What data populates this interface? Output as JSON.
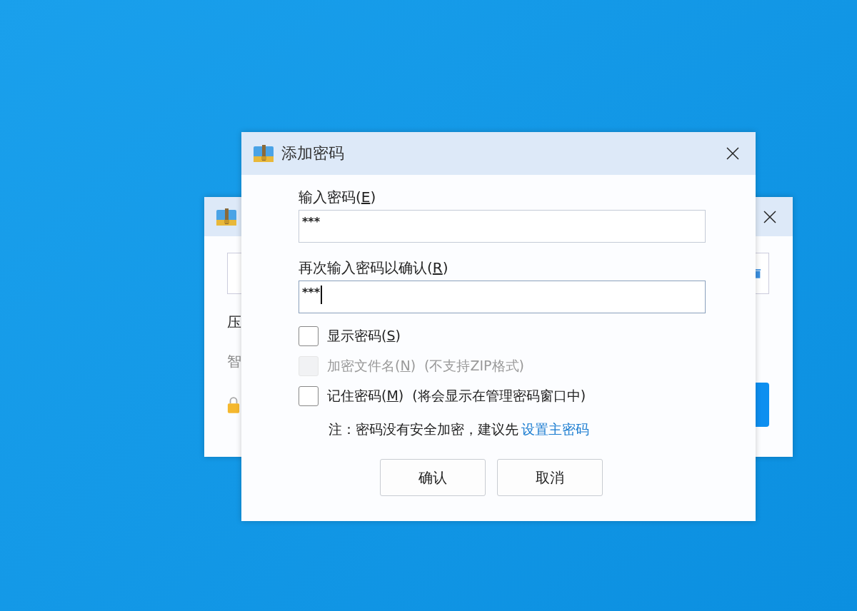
{
  "background_window": {
    "labels": [
      {
        "text": "压",
        "kind": "heading"
      },
      {
        "text": "智",
        "kind": "hint"
      }
    ]
  },
  "dialog": {
    "title": "添加密码",
    "fields": [
      {
        "label": {
          "prefix": "输入密码(",
          "accel": "E",
          "suffix": ")"
        },
        "value": "***",
        "focused": false
      },
      {
        "label": {
          "prefix": "再次输入密码以确认(",
          "accel": "R",
          "suffix": ")"
        },
        "value": "***",
        "focused": true
      }
    ],
    "options": [
      {
        "label": {
          "prefix": "显示密码(",
          "accel": "S",
          "suffix": ")"
        },
        "checked": false,
        "disabled": false
      },
      {
        "label": {
          "prefix": "加密文件名(",
          "accel": "N",
          "suffix": ")"
        },
        "note": "(不支持ZIP格式)",
        "checked": false,
        "disabled": true
      },
      {
        "label": {
          "prefix": "记住密码(",
          "accel": "M",
          "suffix": ")"
        },
        "note": "(将会显示在管理密码窗口中)",
        "checked": false,
        "disabled": false
      }
    ],
    "notice": {
      "text": "注：密码没有安全加密，建议先",
      "link": "设置主密码"
    },
    "buttons": [
      "确认",
      "取消"
    ]
  }
}
